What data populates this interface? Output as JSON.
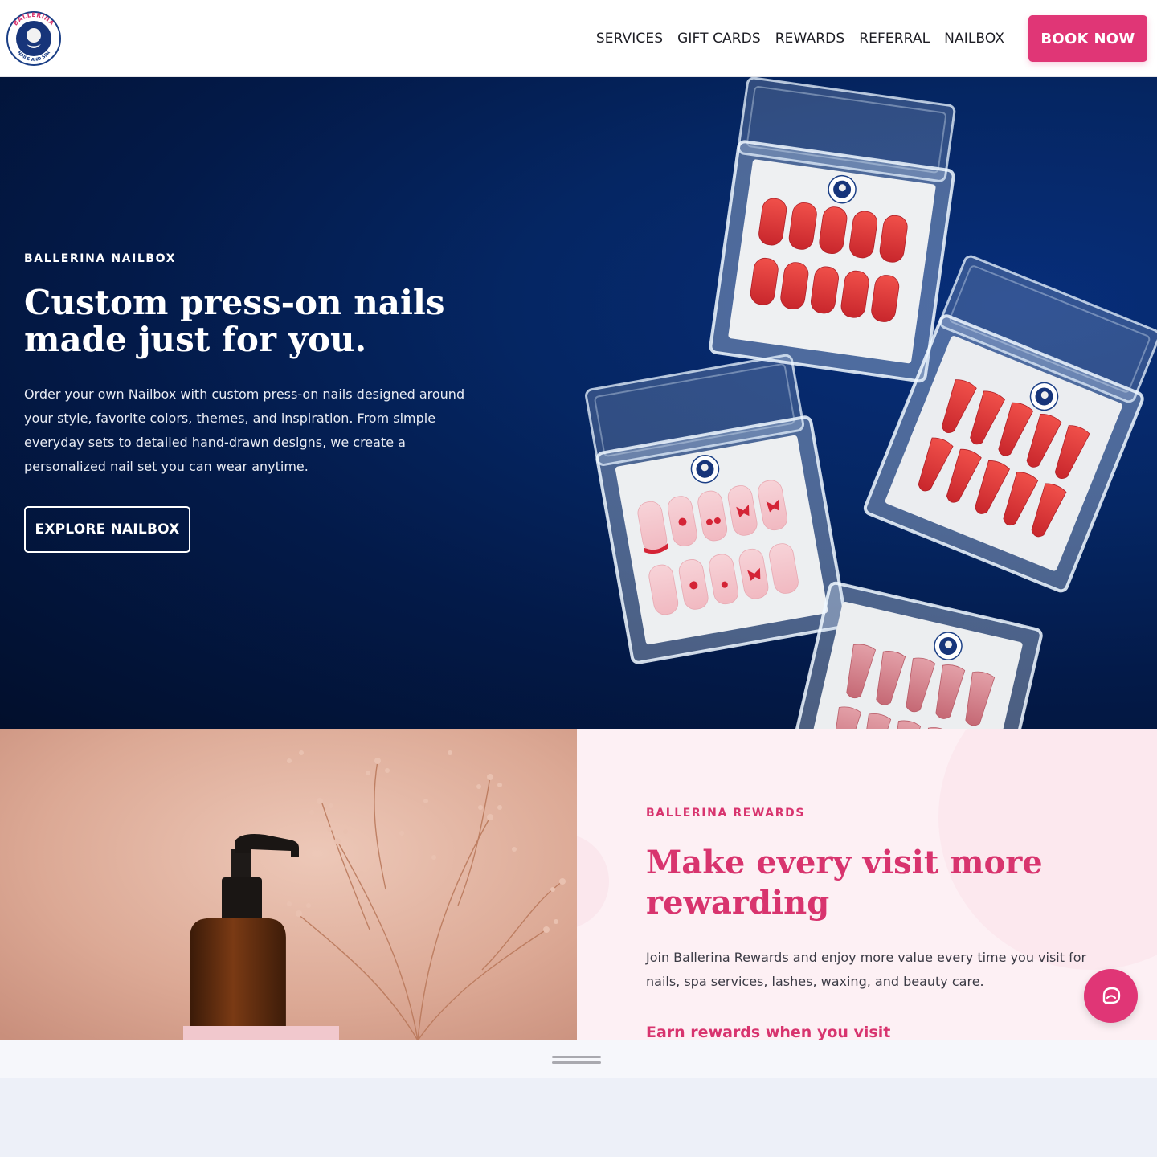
{
  "header": {
    "logo": {
      "top_text": "BALLERINA",
      "bottom_text": "NAILS AND SPA"
    },
    "nav": [
      {
        "label": "SERVICES"
      },
      {
        "label": "GIFT CARDS"
      },
      {
        "label": "REWARDS"
      },
      {
        "label": "REFERRAL"
      },
      {
        "label": "NAILBOX"
      }
    ],
    "book_label": "BOOK NOW"
  },
  "hero": {
    "eyebrow": "BALLERINA NAILBOX",
    "title": "Custom press-on nails made just for you.",
    "description": "Order your own Nailbox with custom press-on nails designed around your style, favorite colors, themes, and inspiration. From simple everyday sets to detailed hand-drawn designs, we create a personalized nail set you can wear anytime.",
    "cta_label": "EXPLORE NAILBOX"
  },
  "rewards": {
    "eyebrow": "BALLERINA REWARDS",
    "title": "Make every visit more rewarding",
    "description": "Join Ballerina Rewards and enjoy more value every time you visit for nails, spa services, lashes, waxing, and beauty care.",
    "subheading": "Earn rewards when you visit"
  },
  "icons": {
    "chat": "chat-bubble-icon",
    "handle": "drag-handle-icon"
  },
  "colors": {
    "brand_pink": "#e03676",
    "hero_navy": "#031a49",
    "rewards_bg": "#fdf0f4"
  }
}
